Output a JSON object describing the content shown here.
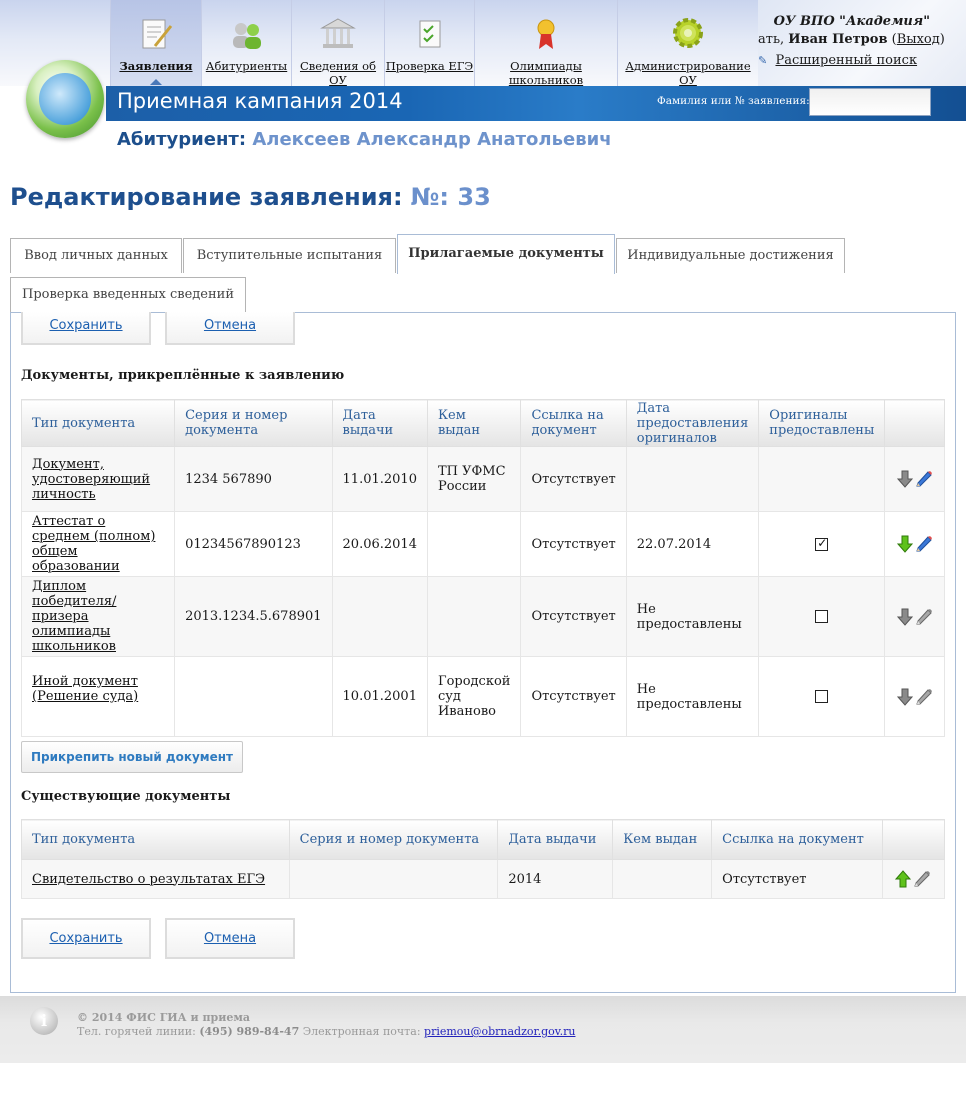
{
  "nav": {
    "items": [
      {
        "label": "Заявления",
        "icon": "applications-icon"
      },
      {
        "label": "Абитуриенты",
        "icon": "applicants-icon"
      },
      {
        "label": "Сведения об ОУ",
        "icon": "institution-icon"
      },
      {
        "label": "Проверка ЕГЭ",
        "icon": "ege-check-icon"
      },
      {
        "label": "Олимпиады школьников",
        "icon": "olympiad-medal-icon"
      },
      {
        "label": "Администрирование ОУ",
        "icon": "gear-icon"
      }
    ]
  },
  "header": {
    "org_name": "ОУ ВПО \"Академия\"",
    "user_prefix": "ать, ",
    "user_name": "Иван Петров",
    "logout": "Выход",
    "advanced_search": "Расширенный поиск",
    "campaign": "Приемная кампания 2014",
    "search_label": "Фамилия или № заявления:",
    "search_value": ""
  },
  "applicant": {
    "label": "Абитуриент:",
    "name": "Алексеев Александр Анатольевич"
  },
  "page": {
    "title": "Редактирование заявления:",
    "number": "№: 33"
  },
  "tabs": [
    {
      "label": "Ввод личных данных",
      "active": false
    },
    {
      "label": "Вступительные испытания",
      "active": false
    },
    {
      "label": "Прилагаемые документы",
      "active": true
    },
    {
      "label": "Индивидуальные достижения",
      "active": false
    },
    {
      "label": "Проверка введенных сведений",
      "active": false
    }
  ],
  "buttons": {
    "save": "Сохранить",
    "cancel": "Отмена",
    "attach_new": "Прикрепить новый документ"
  },
  "attached": {
    "title": "Документы, прикреплённые к заявлению",
    "headers": [
      "Тип документа",
      "Серия и номер документа",
      "Дата выдачи",
      "Кем выдан",
      "Ссылка на документ",
      "Дата предоставления оригиналов",
      "Оригиналы предоставлены"
    ],
    "rows": [
      {
        "type": "Документ, удостоверяющий личность",
        "number": "1234 567890",
        "date": "11.01.2010",
        "issuer": "ТП УФМС России",
        "link": "Отсутствует",
        "orig_date": "",
        "originals": null,
        "arrow": "gray-down"
      },
      {
        "type": "Аттестат о среднем (полном) общем образовании",
        "number": "01234567890123",
        "date": "20.06.2014",
        "issuer": "",
        "link": "Отсутствует",
        "orig_date": "22.07.2014",
        "originals": true,
        "arrow": "green-down"
      },
      {
        "type": "Диплом победителя/призера олимпиады школьников",
        "number": "2013.1234.5.678901",
        "date": "",
        "issuer": "",
        "link": "Отсутствует",
        "orig_date": "Не предоставлены",
        "originals": false,
        "arrow": "gray-down"
      },
      {
        "type": "Иной документ (Решение суда)",
        "number": "",
        "date": "10.01.2001",
        "issuer": "Городской суд Иваново",
        "link": "Отсутствует",
        "orig_date": "Не предоставлены",
        "originals": false,
        "arrow": "gray-down"
      }
    ]
  },
  "existing": {
    "title": "Существующие документы",
    "headers": [
      "Тип документа",
      "Серия и номер документа",
      "Дата выдачи",
      "Кем выдан",
      "Ссылка на документ"
    ],
    "rows": [
      {
        "type": "Свидетельство о результатах ЕГЭ",
        "number": "",
        "date": "2014",
        "issuer": "",
        "link": "Отсутствует"
      }
    ]
  },
  "footer": {
    "copyright": "© 2014 ФИС ГИА и приема",
    "hotline_label": "Тел. горячей линии:",
    "hotline": "(495) 989-84-47",
    "email_label": "Электронная почта:",
    "email": "priemou@obrnadzor.gov.ru"
  }
}
